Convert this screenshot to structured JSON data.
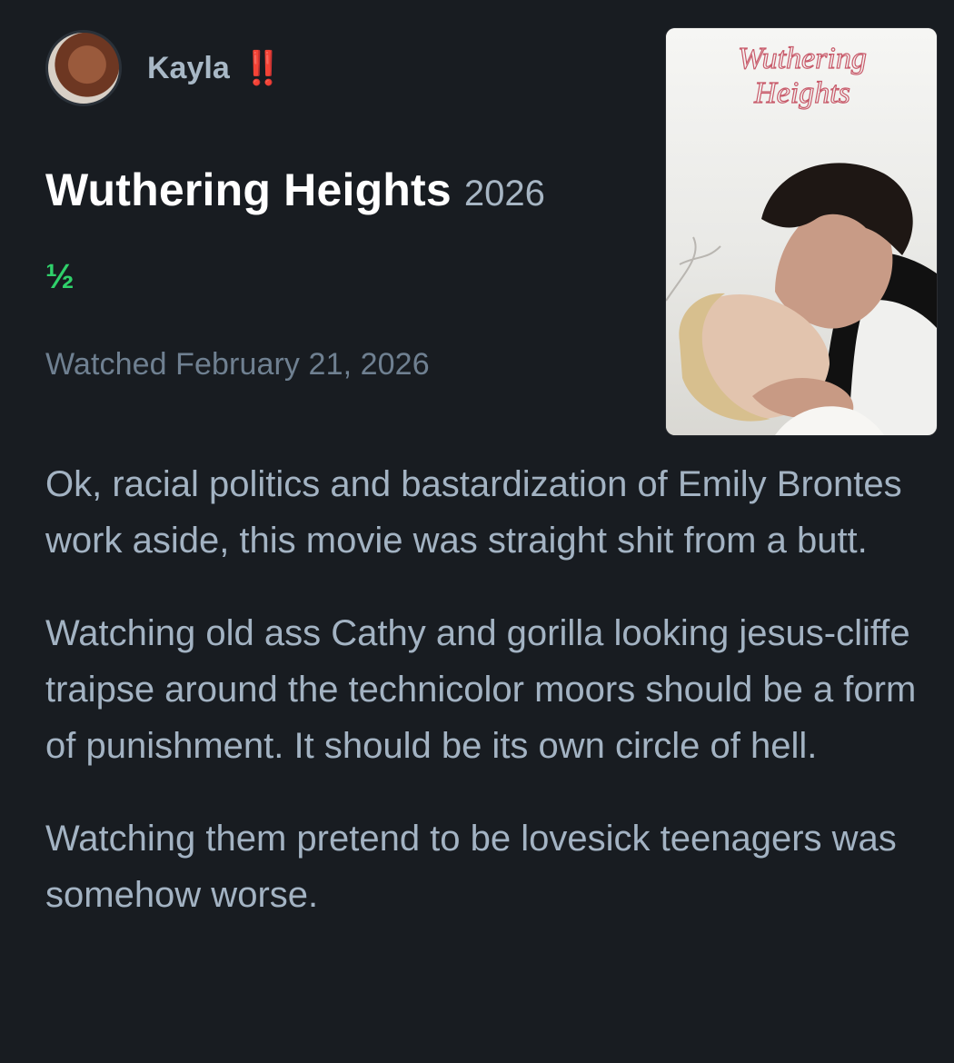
{
  "user": {
    "name": "Kayla",
    "badge": "‼️"
  },
  "film": {
    "title": "Wuthering Heights",
    "year": "2026",
    "rating": "½",
    "watched_text": "Watched February 21, 2026",
    "poster": {
      "title_line1": "Wuthering",
      "title_line2": "Heights"
    }
  },
  "review": {
    "paragraphs": [
      "Ok, racial politics and bastardization of Emily Brontes work aside, this movie was straight shit from a butt.",
      "Watching old ass Cathy and gorilla looking jesus-cliffe traipse around the technicolor moors should be a form of punishment. It should be its own circle of hell.",
      "Watching them pretend to be lovesick teenagers was somehow worse."
    ]
  },
  "colors": {
    "background": "#181c21",
    "rating_green": "#2fd06a",
    "badge_red": "#e0304a"
  }
}
